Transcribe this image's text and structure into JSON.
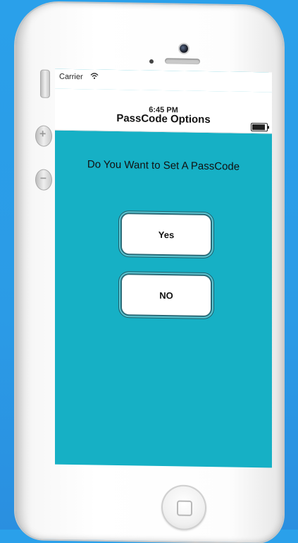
{
  "status_bar": {
    "carrier": "Carrier",
    "time": "6:45 PM"
  },
  "nav": {
    "title": "PassCode Options"
  },
  "prompt": {
    "question": "Do You Want to Set A PassCode"
  },
  "buttons": {
    "yes": "Yes",
    "no": "NO"
  },
  "colors": {
    "background": "#2aa0ea",
    "screen": "#16b0c5",
    "button_border": "#2a6b78"
  },
  "icons": [
    "wifi-icon",
    "battery-icon",
    "camera-icon",
    "home-button-icon"
  ]
}
